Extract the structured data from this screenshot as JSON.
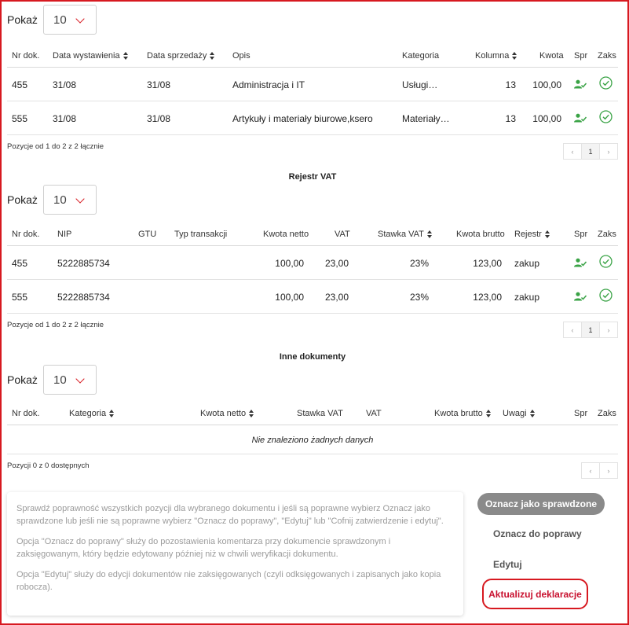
{
  "show_label": "Pokaż",
  "page_size": "10",
  "colors": {
    "accent": "#d71920",
    "success": "#3aa346",
    "button_grey": "#8a8a8a"
  },
  "documents": {
    "headers": [
      "Nr dok.",
      "Data wystawienia",
      "Data sprzedaży",
      "Opis",
      "Kategoria",
      "Kolumna",
      "Kwota",
      "Spr",
      "Zaks"
    ],
    "rows": [
      {
        "nr": "455",
        "data_wyst": "31/08",
        "data_sprz": "31/08",
        "opis": "Administracja i IT",
        "kategoria": "Usługi…",
        "kolumna": "13",
        "kwota": "100,00"
      },
      {
        "nr": "555",
        "data_wyst": "31/08",
        "data_sprz": "31/08",
        "opis": "Artykuły i materiały biurowe,ksero",
        "kategoria": "Materiały…",
        "kolumna": "13",
        "kwota": "100,00"
      }
    ],
    "info": "Pozycje od 1 do 2 z 2 łącznie",
    "pager": {
      "prev": "‹",
      "current": "1",
      "next": "›"
    }
  },
  "vat": {
    "title": "Rejestr VAT",
    "headers": [
      "Nr dok.",
      "NIP",
      "GTU",
      "Typ transakcji",
      "Kwota netto",
      "VAT",
      "Stawka VAT",
      "Kwota brutto",
      "Rejestr",
      "Spr",
      "Zaks"
    ],
    "rows": [
      {
        "nr": "455",
        "nip": "5222885734",
        "netto": "100,00",
        "vat": "23,00",
        "stawka": "23%",
        "brutto": "123,00",
        "rejestr": "zakup"
      },
      {
        "nr": "555",
        "nip": "5222885734",
        "netto": "100,00",
        "vat": "23,00",
        "stawka": "23%",
        "brutto": "123,00",
        "rejestr": "zakup"
      }
    ],
    "info": "Pozycje od 1 do 2 z 2 łącznie",
    "pager": {
      "prev": "‹",
      "current": "1",
      "next": "›"
    }
  },
  "other": {
    "title": "Inne dokumenty",
    "headers": [
      "Nr dok.",
      "Kategoria",
      "Kwota netto",
      "Stawka VAT",
      "VAT",
      "Kwota brutto",
      "Uwagi",
      "Spr",
      "Zaks"
    ],
    "empty": "Nie znaleziono żadnych danych",
    "info": "Pozycji 0 z 0 dostępnych",
    "pager": {
      "prev": "‹",
      "next": "›"
    }
  },
  "help": {
    "p1": "Sprawdź poprawność wszystkich pozycji dla wybranego dokumentu i jeśli są poprawne wybierz Oznacz jako sprawdzone lub jeśli nie są poprawne wybierz \"Oznacz do poprawy\", \"Edytuj\" lub \"Cofnij zatwierdzenie i edytuj\".",
    "p2": "Opcja \"Oznacz do poprawy\" służy do pozostawienia komentarza przy dokumencie sprawdzonym i zaksięgowanym, który będzie edytowany później niż w chwili weryfikacji dokumentu.",
    "p3": "Opcja \"Edytuj\" służy do edycji dokumentów nie zaksięgowanych (czyli odksięgowanych i zapisanych jako kopia robocza)."
  },
  "actions": {
    "mark_checked": "Oznacz jako sprawdzone",
    "mark_fix": "Oznacz do poprawy",
    "edit": "Edytuj",
    "update_declaration": "Aktualizuj deklaracje"
  }
}
